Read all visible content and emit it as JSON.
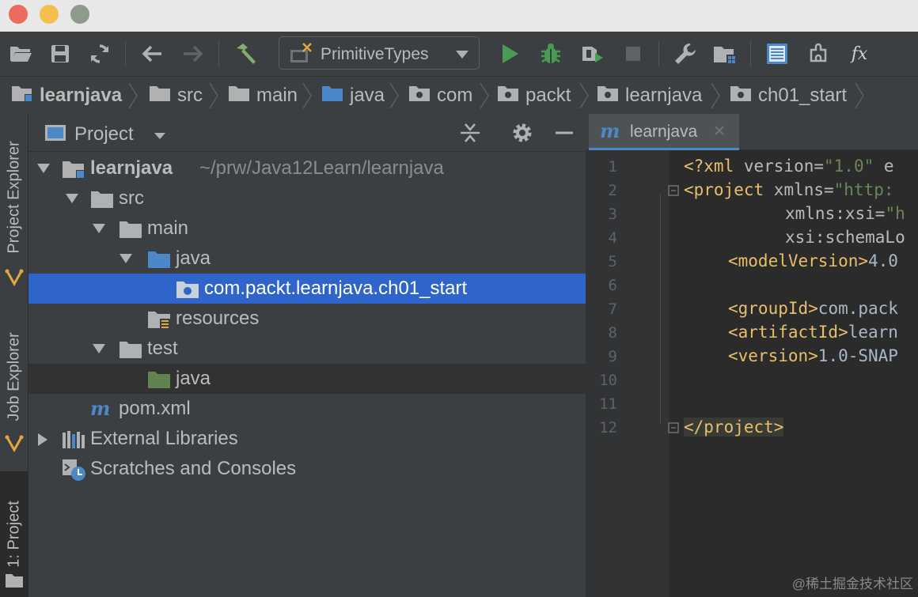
{
  "window": {
    "traffic_lights": [
      "#ed6a5e",
      "#f5bf4f",
      "#8c9b8c"
    ]
  },
  "toolbar": {
    "run_config_label": "PrimitiveTypes",
    "icons": [
      "open-folder-icon",
      "save-icon",
      "sync-icon",
      "back-icon",
      "forward-icon",
      "build-hammer-icon",
      "run-icon",
      "debug-icon",
      "coverage-icon",
      "stop-icon",
      "settings-wrench-icon",
      "project-structure-icon",
      "structure-view-icon",
      "plugin-icon",
      "function-icon"
    ]
  },
  "breadcrumb": {
    "items": [
      {
        "label": "learnjava",
        "icon": "module-icon"
      },
      {
        "label": "src",
        "icon": "folder-icon"
      },
      {
        "label": "main",
        "icon": "folder-icon"
      },
      {
        "label": "java",
        "icon": "source-folder-icon"
      },
      {
        "label": "com",
        "icon": "package-icon"
      },
      {
        "label": "packt",
        "icon": "package-icon"
      },
      {
        "label": "learnjava",
        "icon": "package-icon"
      },
      {
        "label": "ch01_start",
        "icon": "package-icon"
      }
    ]
  },
  "side_tabs": {
    "project_explorer": "Project Explorer",
    "job_explorer": "Job Explorer",
    "project": "1: Project"
  },
  "project_panel": {
    "title": "Project",
    "tree": [
      {
        "label": "learnjava",
        "path_hint": "~/prw/Java12Learn/learnjava",
        "expanded": true
      },
      {
        "label": "src",
        "expanded": true
      },
      {
        "label": "main",
        "expanded": true
      },
      {
        "label": "java",
        "expanded": true
      },
      {
        "label": "com.packt.learnjava.ch01_start",
        "selected": true
      },
      {
        "label": "resources"
      },
      {
        "label": "test",
        "expanded": true
      },
      {
        "label": "java"
      },
      {
        "label": "pom.xml"
      },
      {
        "label": "External Libraries",
        "expanded": false
      },
      {
        "label": "Scratches and Consoles"
      }
    ]
  },
  "editor": {
    "tab_label": "learnjava",
    "line_numbers": [
      "1",
      "2",
      "3",
      "4",
      "5",
      "6",
      "7",
      "8",
      "9",
      "10",
      "11",
      "12"
    ],
    "lines": {
      "l1a": "<?xml ",
      "l1b": "version=",
      "l1c": "\"1.0\"",
      "l1d": " e",
      "l2a": "<project ",
      "l2b": "xmlns=",
      "l2c": "\"http:",
      "l3a": "xmlns:xsi=",
      "l3b": "\"h",
      "l4a": "xsi:schemaLo",
      "l5a": "<modelVersion>",
      "l5b": "4.0",
      "l7a": "<groupId>",
      "l7b": "com.pack",
      "l8a": "<artifactId>",
      "l8b": "learn",
      "l9a": "<version>",
      "l9b": "1.0-SNAP",
      "l12a": "</project>"
    }
  },
  "watermark": "@稀土掘金技术社区"
}
